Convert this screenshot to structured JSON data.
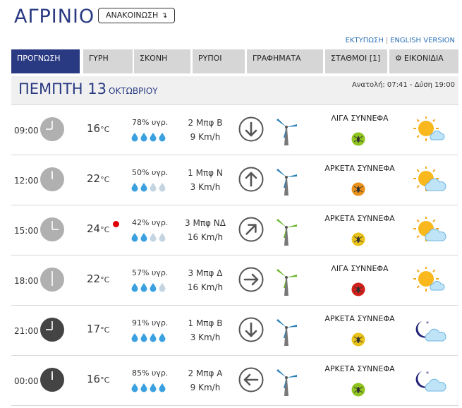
{
  "header": {
    "city": "ΑΓΡΙΝΙΟ",
    "announce_label": "ΑΝΑΚΟΙΝΩΣΗ",
    "announce_icon": "arrow-turn-down-icon",
    "print_link": "ΕΚΤΥΠΩΣΗ",
    "link_separator": "|",
    "english_link": "ENGLISH VERSION"
  },
  "tabs": [
    {
      "label": "ΠΡΟΓΝΩΣΗ",
      "active": true
    },
    {
      "label": "ΓΥΡΗ",
      "active": false
    },
    {
      "label": "ΣΚΟΝΗ",
      "active": false
    },
    {
      "label": "ΡΥΠΟΙ",
      "active": false
    },
    {
      "label": "ΓΡΑΦΗΜΑΤΑ",
      "active": false
    },
    {
      "label": "ΣΤΑΘΜΟΙ [1]",
      "active": false
    },
    {
      "label": "ΕΙΚΟΝΙΔΙΑ",
      "active": false,
      "icon": "gear-icon"
    }
  ],
  "day": {
    "weekday_date": "ΠΕΜΠΤΗ 13",
    "month": "ΟΚΤΩΒΡΙΟΥ",
    "sun_times": "Ανατολή: 07:41  - Δύση 19:00"
  },
  "colors": {
    "brand": "#2a3a82",
    "tab_bg": "#d6d6d6",
    "drop_full": "#3aa0e0",
    "drop_empty": "#c4d4e0",
    "alert": "#e00000",
    "bug_green": "#8fc31f",
    "bug_yellow": "#e8c21a",
    "bug_orange": "#e8901a",
    "bug_red": "#d0201a"
  },
  "forecast": [
    {
      "time": "09:00",
      "hour": 9,
      "night": false,
      "temp": "16",
      "unit": "°C",
      "alert": false,
      "humidity": "78% υγρ.",
      "drops_filled": 4,
      "wind_bft": "2 Μπφ Β",
      "wind_kmh": "9 Km/h",
      "arrow_icon": "arrow-down-icon",
      "arrow_deg": 180,
      "turbine_color": "#2a7fb8",
      "condition": "ΛΙΓΑ ΣΥΝΝΕΦΑ",
      "bug_color": "#8fc31f",
      "weather_icon": "sun-cloud-icon"
    },
    {
      "time": "12:00",
      "hour": 12,
      "night": false,
      "temp": "22",
      "unit": "°C",
      "alert": false,
      "humidity": "50% υγρ.",
      "drops_filled": 2,
      "wind_bft": "1 Μπφ Ν",
      "wind_kmh": "3 Km/h",
      "arrow_icon": "arrow-up-icon",
      "arrow_deg": 0,
      "turbine_color": "#2a7fb8",
      "condition": "ΑΡΚΕΤΑ ΣΥΝΝΕΦΑ",
      "bug_color": "#e8901a",
      "weather_icon": "sun-clouds-icon"
    },
    {
      "time": "15:00",
      "hour": 15,
      "night": false,
      "temp": "24",
      "unit": "°C",
      "alert": true,
      "humidity": "42% υγρ.",
      "drops_filled": 2,
      "wind_bft": "3 Μπφ ΝΔ",
      "wind_kmh": "16 Km/h",
      "arrow_icon": "arrow-up-right-icon",
      "arrow_deg": 45,
      "turbine_color": "#6ab42a",
      "condition": "ΑΡΚΕΤΑ ΣΥΝΝΕΦΑ",
      "bug_color": "#e8c21a",
      "weather_icon": "sun-clouds-icon"
    },
    {
      "time": "18:00",
      "hour": 18,
      "night": false,
      "temp": "22",
      "unit": "°C",
      "alert": false,
      "humidity": "57% υγρ.",
      "drops_filled": 3,
      "wind_bft": "3 Μπφ Δ",
      "wind_kmh": "16 Km/h",
      "arrow_icon": "arrow-right-icon",
      "arrow_deg": 90,
      "turbine_color": "#6ab42a",
      "condition": "ΛΙΓΑ ΣΥΝΝΕΦΑ",
      "bug_color": "#d0201a",
      "weather_icon": "sun-cloud-icon"
    },
    {
      "time": "21:00",
      "hour": 21,
      "night": true,
      "temp": "17",
      "unit": "°C",
      "alert": false,
      "humidity": "91% υγρ.",
      "drops_filled": 4,
      "wind_bft": "1 Μπφ Β",
      "wind_kmh": "3 Km/h",
      "arrow_icon": "arrow-down-icon",
      "arrow_deg": 180,
      "turbine_color": "#2a7fb8",
      "condition": "ΑΡΚΕΤΑ ΣΥΝΝΕΦΑ",
      "bug_color": "#e8c21a",
      "weather_icon": "moon-clouds-icon"
    },
    {
      "time": "00:00",
      "hour": 0,
      "night": true,
      "temp": "16",
      "unit": "°C",
      "alert": false,
      "humidity": "85% υγρ.",
      "drops_filled": 4,
      "wind_bft": "2 Μπφ Α",
      "wind_kmh": "9 Km/h",
      "arrow_icon": "arrow-left-icon",
      "arrow_deg": 270,
      "turbine_color": "#2a7fb8",
      "condition": "ΑΡΚΕΤΑ ΣΥΝΝΕΦΑ",
      "bug_color": "#8fc31f",
      "weather_icon": "moon-clouds-icon"
    }
  ]
}
